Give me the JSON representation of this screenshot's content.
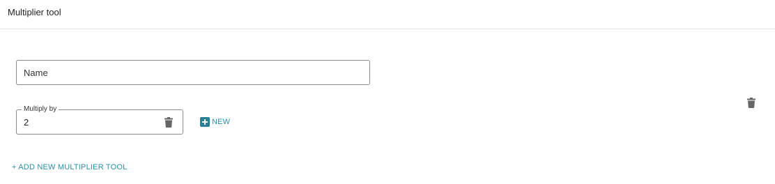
{
  "header": {
    "title": "Multiplier tool"
  },
  "name_field": {
    "placeholder": "Name"
  },
  "multiply_field": {
    "label": "Multiply by",
    "value": "2"
  },
  "new_button": {
    "label": "NEW"
  },
  "add_tool_link": {
    "label": "+ ADD NEW MULTIPLIER TOOL"
  },
  "colors": {
    "accent": "#2b8ea8",
    "icon": "#666666",
    "border": "#8a8a8a"
  },
  "icons": {
    "delete": "trash-icon",
    "add": "plus-square-icon"
  }
}
